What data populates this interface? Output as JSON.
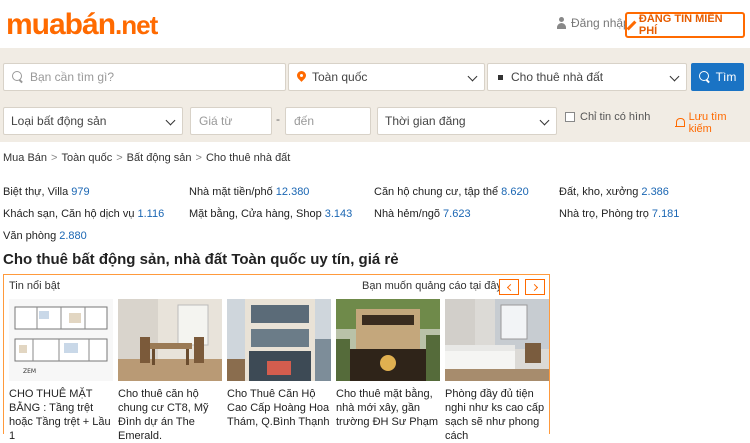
{
  "header": {
    "logo_main": "muabán",
    "logo_tld": ".net",
    "login": "Đăng nhập",
    "post_ad": "ĐĂNG TIN MIỄN PHÍ"
  },
  "search": {
    "query_placeholder": "Bạn cần tìm gì?",
    "location": "Toàn quốc",
    "category": "Cho thuê nhà đất",
    "button": "Tìm",
    "type_placeholder": "Loại bất động sản",
    "price_from": "Giá từ",
    "price_sep": "-",
    "price_to": "đến",
    "time_placeholder": "Thời gian đăng",
    "images_only": "Chỉ tin có hình",
    "save_search": "Lưu tìm kiếm"
  },
  "breadcrumb": [
    "Mua Bán",
    "Toàn quốc",
    "Bất động sản",
    "Cho thuê nhà đất"
  ],
  "categories": [
    {
      "name": "Biệt thự, Villa",
      "count": "979"
    },
    {
      "name": "Nhà mặt tiền/phố",
      "count": "12.380"
    },
    {
      "name": "Căn hộ chung cư, tập thể",
      "count": "8.620"
    },
    {
      "name": "Đất, kho, xưởng",
      "count": "2.386"
    },
    {
      "name": "Khách sạn, Căn hộ dịch vụ",
      "count": "1.116"
    },
    {
      "name": "Mặt bằng, Cửa hàng, Shop",
      "count": "3.143"
    },
    {
      "name": "Nhà hẻm/ngõ",
      "count": "7.623"
    },
    {
      "name": "Nhà trọ, Phòng trọ",
      "count": "7.181"
    },
    {
      "name": "Văn phòng",
      "count": "2.880"
    }
  ],
  "section_title": "Cho thuê bất động sản, nhà đất Toàn quốc uy tín, giá rẻ",
  "featured": {
    "label": "Tin nổi bật",
    "ad_text": "Bạn muốn quảng cáo tại đây?",
    "items": [
      {
        "title": "CHO THUÊ MẶT BẰNG : Tầng trệt hoặc Tầng trệt + Lầu 1"
      },
      {
        "title": "Cho thuê căn hộ chung cư CT8, Mỹ Đình dự án The Emerald."
      },
      {
        "title": "Cho Thuê Căn Hộ Cao Cấp Hoàng Hoa Thám, Q.Bình Thạnh"
      },
      {
        "title": "Cho thuê mặt bằng, nhà mới xây, gần trường ĐH Sư Phạm"
      },
      {
        "title": "Phòng đầy đủ tiện nghi như ks cao cấp sạch sẽ như phong cách"
      }
    ]
  }
}
